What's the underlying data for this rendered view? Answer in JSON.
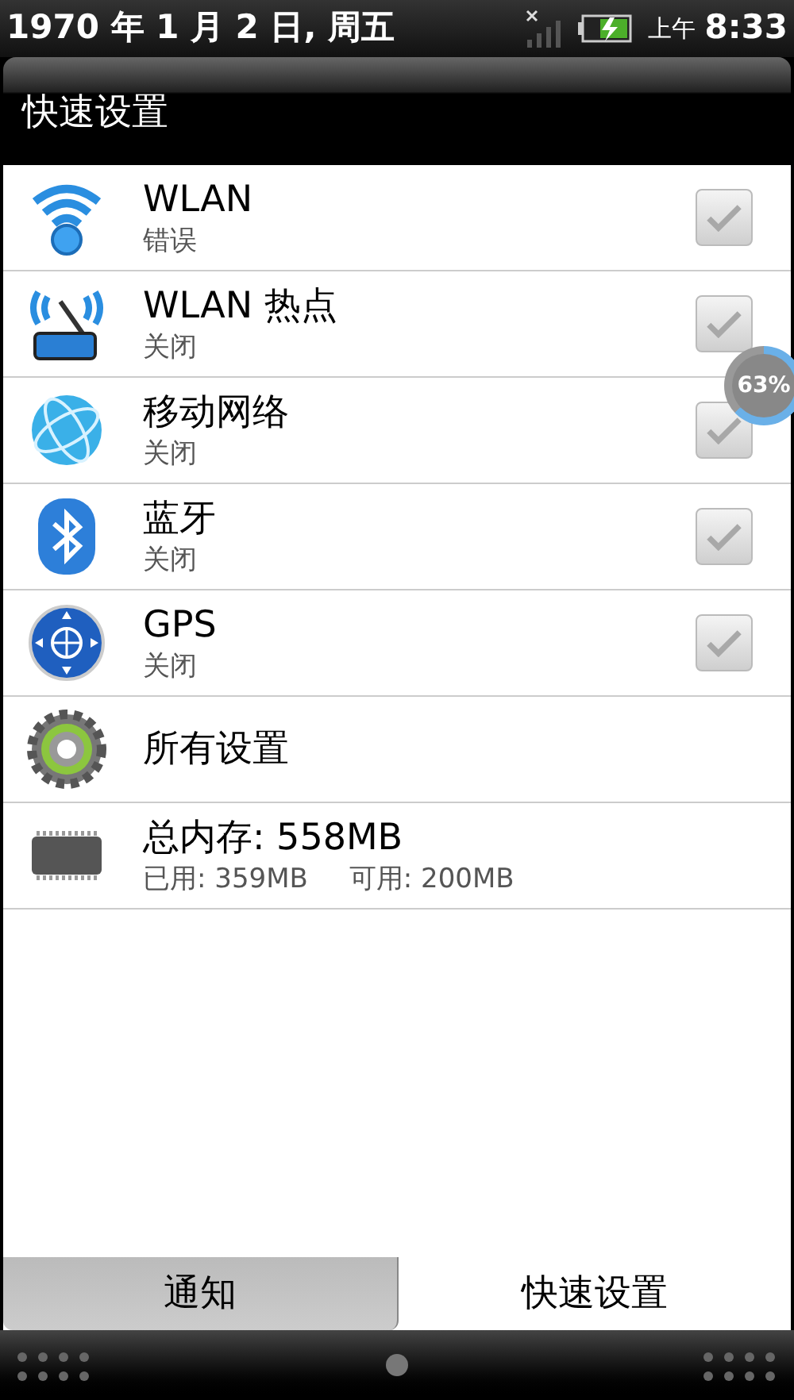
{
  "status_bar": {
    "date": "1970 年 1 月 2 日, 周五",
    "ampm": "上午",
    "time": "8:33"
  },
  "header": {
    "title": "快速设置"
  },
  "items": [
    {
      "kind": "toggle",
      "title": "WLAN",
      "subtitle": "错误",
      "checked": false
    },
    {
      "kind": "toggle",
      "title": "WLAN 热点",
      "subtitle": "关闭",
      "checked": false
    },
    {
      "kind": "toggle",
      "title": "移动网络",
      "subtitle": "关闭",
      "checked": false
    },
    {
      "kind": "toggle",
      "title": "蓝牙",
      "subtitle": "关闭",
      "checked": false
    },
    {
      "kind": "toggle",
      "title": "GPS",
      "subtitle": "关闭",
      "checked": false
    },
    {
      "kind": "link",
      "title": "所有设置"
    },
    {
      "kind": "memory",
      "title": "总内存: 558MB",
      "used": "已用: 359MB",
      "free": "可用: 200MB"
    }
  ],
  "overlay_badge": {
    "text": "63%"
  },
  "tabs": [
    {
      "label": "通知",
      "selected": false
    },
    {
      "label": "快速设置",
      "selected": true
    }
  ]
}
